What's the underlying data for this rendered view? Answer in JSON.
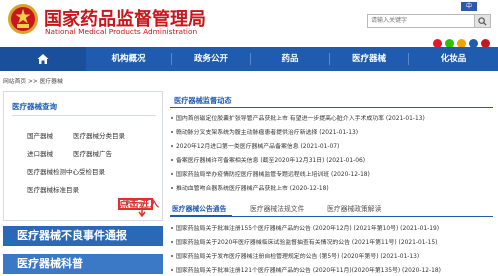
{
  "header": {
    "title": "国家药品监督管理局",
    "subtitle": "National Medical Products Administration",
    "lang_button": "中",
    "search_placeholder": "请输入关键字"
  },
  "nav": {
    "items": [
      {
        "label": "机构概况"
      },
      {
        "label": "政务公开"
      },
      {
        "label": "药品"
      },
      {
        "label": "医疗器械"
      },
      {
        "label": "化妆品"
      }
    ]
  },
  "breadcrumb": "网站首页 >> 医疗器械",
  "sidebar": {
    "heading": "医疗器械查询",
    "links": [
      {
        "label": "国产器械"
      },
      {
        "label": "医疗器械分类目录"
      },
      {
        "label": "进口器械"
      },
      {
        "label": "医疗器械广告"
      },
      {
        "label": "医疗器械检测中心受检目录"
      },
      {
        "label": "医疗器械标准目录"
      }
    ],
    "more_label": "更多>>",
    "annotation": "点击进入",
    "banner1": "医疗器械不良事件通报",
    "banner2": "医疗器械科普"
  },
  "dynamics": {
    "title": "医疗器械监督动态",
    "items": [
      {
        "text": "国内首创磁定位胶囊扩张导管产品获批上市 有望进一步提高心脏介入手术成功率 (2021-01-13)"
      },
      {
        "text": "赣动脉分叉支架系统为腹主动脉瘤患者提供治疗新选择 (2021-01-13)"
      },
      {
        "text": "2020年12月进口第一类医疗器械产品备案信息 (2021-01-07)"
      },
      {
        "text": "备案医疗器械许可备案相关信息 (截至2020年12月31日) (2021-01-06)"
      },
      {
        "text": "国家药监局举办疫情防控医疗器械监管专题远程线上培训班 (2020-12-18)"
      },
      {
        "text": "推动血管吻合器系统医疗器械产品获批上市 (2020-12-18)"
      }
    ]
  },
  "tabs": [
    {
      "label": "医疗器械公告通告"
    },
    {
      "label": "医疗器械法规文件"
    },
    {
      "label": "医疗器械政策解读"
    }
  ],
  "notices": {
    "items": [
      {
        "text": "国家药监局关于批准注册155个医疗器械产品的公告 (2020年12月) (2021年第10号) (2021-01-19)"
      },
      {
        "text": "国家药监局关于2020年医疗器械临床试验监督抽查有关情况的公告 (2021年第11号) (2021-01-15)"
      },
      {
        "text": "国家药监局关于发布医疗器械注册自检管理规定的公告 (第5号) (2020年第号) (2021-01-13)"
      },
      {
        "text": "国家药监局关于批准注册121个医疗器械产品的公告 (2020年11月)(2020年第135号) (2020-12-18)"
      }
    ]
  },
  "colors": {
    "brand_red": "#c8161d",
    "nav_blue": "#1f5cb0",
    "highlight_red": "#e0312f"
  }
}
